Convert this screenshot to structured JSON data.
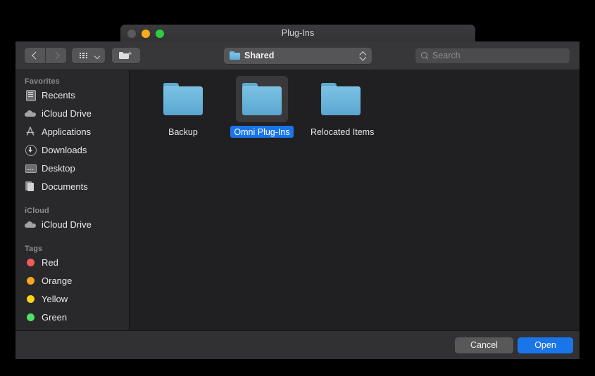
{
  "window": {
    "title": "Plug-Ins",
    "traffic_lights": [
      {
        "name": "close",
        "color": "#5a5a5d"
      },
      {
        "name": "minimize",
        "color": "#f5ac1d"
      },
      {
        "name": "zoom",
        "color": "#32c942"
      }
    ]
  },
  "toolbar": {
    "back_icon": "chevron-left-icon",
    "forward_icon": "chevron-right-icon",
    "view_mode_icon": "grid-view-icon",
    "view_mode_chevron": "chevron-down-icon",
    "new_folder_icon": "new-folder-icon",
    "path_popup": {
      "icon": "folder-icon",
      "label": "Shared",
      "stepper_icon": "up-down-chevron-icon"
    },
    "search": {
      "icon": "search-icon",
      "placeholder": "Search",
      "value": ""
    }
  },
  "sidebar": {
    "sections": [
      {
        "header": "Favorites",
        "items": [
          {
            "label": "Recents",
            "icon": "recents-icon"
          },
          {
            "label": "iCloud Drive",
            "icon": "cloud-icon"
          },
          {
            "label": "Applications",
            "icon": "applications-icon"
          },
          {
            "label": "Downloads",
            "icon": "downloads-icon"
          },
          {
            "label": "Desktop",
            "icon": "desktop-icon"
          },
          {
            "label": "Documents",
            "icon": "documents-icon"
          }
        ]
      },
      {
        "header": "iCloud",
        "items": [
          {
            "label": "iCloud Drive",
            "icon": "cloud-icon"
          }
        ]
      },
      {
        "header": "Tags",
        "items": [
          {
            "label": "Red",
            "icon": "tag-dot-icon",
            "color": "#f05b5b"
          },
          {
            "label": "Orange",
            "icon": "tag-dot-icon",
            "color": "#f5a623"
          },
          {
            "label": "Yellow",
            "icon": "tag-dot-icon",
            "color": "#f7d518"
          },
          {
            "label": "Green",
            "icon": "tag-dot-icon",
            "color": "#4ce364"
          }
        ]
      }
    ]
  },
  "content": {
    "view": "icon",
    "items": [
      {
        "name": "Backup",
        "icon": "folder-icon",
        "selected": false
      },
      {
        "name": "Omni Plug-Ins",
        "icon": "folder-icon",
        "selected": true
      },
      {
        "name": "Relocated Items",
        "icon": "folder-icon",
        "selected": false
      }
    ]
  },
  "footer": {
    "cancel_label": "Cancel",
    "open_label": "Open",
    "accent_color": "#1a75e8"
  }
}
